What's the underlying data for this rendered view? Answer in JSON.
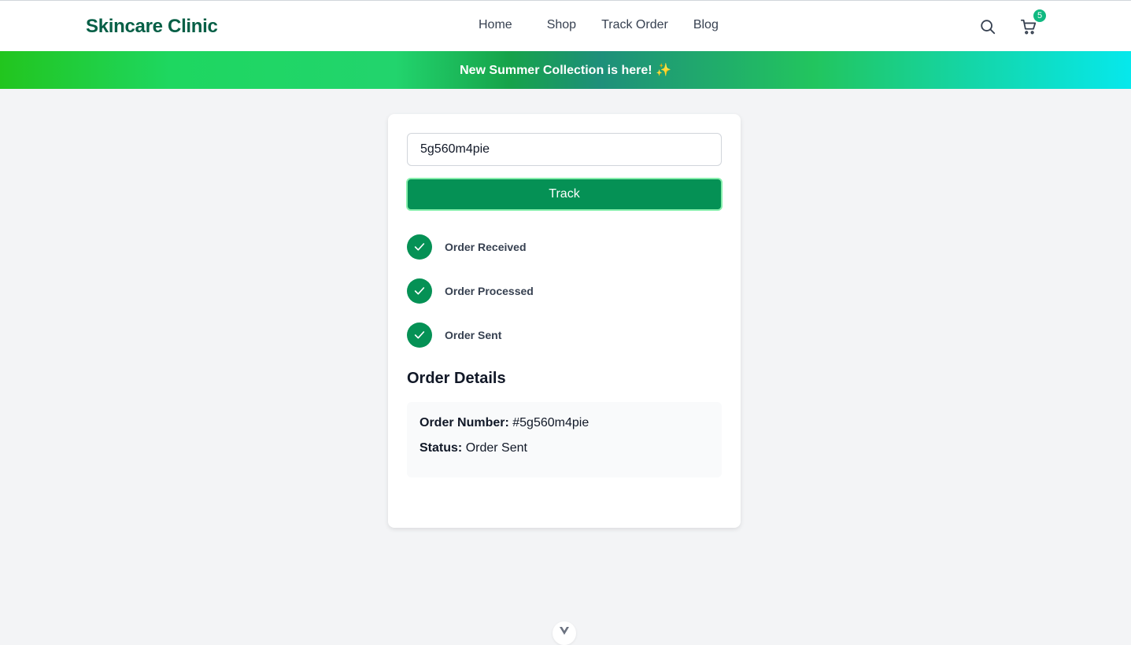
{
  "header": {
    "brand": "Skincare Clinic",
    "nav": [
      "Home",
      "Shop",
      "Track Order",
      "Blog"
    ],
    "cart_count": "5"
  },
  "promo": {
    "text": "New Summer Collection is here! ✨"
  },
  "tracker": {
    "order_input_value": "5g560m4pie",
    "track_button": "Track",
    "steps": [
      "Order Received",
      "Order Processed",
      "Order Sent"
    ],
    "details_title": "Order Details",
    "order_number_label": "Order Number:",
    "order_number_value": "#5g560m4pie",
    "status_label": "Status:",
    "status_value": "Order Sent"
  },
  "colors": {
    "brand": "#065f46",
    "accent": "#059155",
    "badge": "#10b981"
  },
  "icons": {
    "search": "search-icon",
    "cart": "cart-icon",
    "check": "check-icon",
    "scroll": "chevron-down-icon"
  }
}
